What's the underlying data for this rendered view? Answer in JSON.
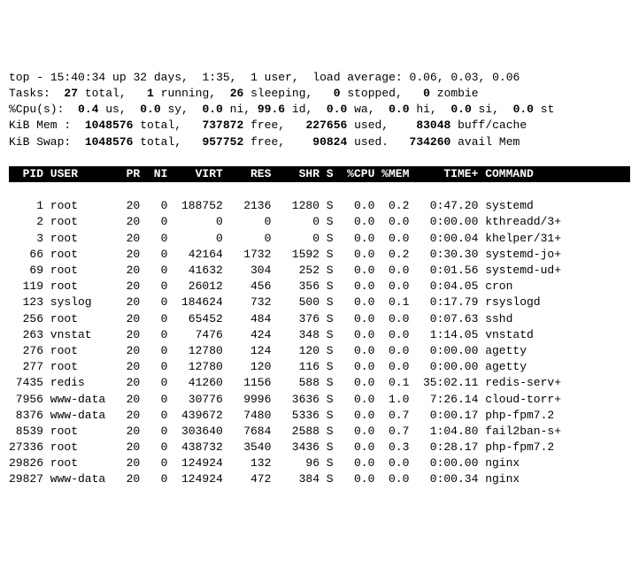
{
  "summary": {
    "line1_prefix": "top - ",
    "time": "15:40:34",
    "up_label": " up ",
    "uptime": "32 days,  1:35",
    "users_sep": ",  ",
    "users": "1 user",
    "load_label": ",  load average: ",
    "load": "0.06, 0.03, 0.06",
    "tasks_label": "Tasks:  ",
    "tasks_total": "27",
    "tasks_total_suffix": " total,   ",
    "tasks_running": "1",
    "tasks_running_suffix": " running,  ",
    "tasks_sleeping": "26",
    "tasks_sleeping_suffix": " sleeping,   ",
    "tasks_stopped": "0",
    "tasks_stopped_suffix": " stopped,   ",
    "tasks_zombie": "0",
    "tasks_zombie_suffix": " zombie",
    "cpu_label": "%Cpu(s):  ",
    "cpu_us": "0.4",
    "cpu_us_suffix": " us,  ",
    "cpu_sy": "0.0",
    "cpu_sy_suffix": " sy,  ",
    "cpu_ni": "0.0",
    "cpu_ni_suffix": " ni, ",
    "cpu_id": "99.6",
    "cpu_id_suffix": " id,  ",
    "cpu_wa": "0.0",
    "cpu_wa_suffix": " wa,  ",
    "cpu_hi": "0.0",
    "cpu_hi_suffix": " hi,  ",
    "cpu_si": "0.0",
    "cpu_si_suffix": " si,  ",
    "cpu_st": "0.0",
    "cpu_st_suffix": " st",
    "mem_label": "KiB Mem :  ",
    "mem_total": "1048576",
    "mem_total_suffix": " total,   ",
    "mem_free": "737872",
    "mem_free_suffix": " free,   ",
    "mem_used": "227656",
    "mem_used_suffix": " used,    ",
    "mem_buff": "83048",
    "mem_buff_suffix": " buff/cache",
    "swap_label": "KiB Swap:  ",
    "swap_total": "1048576",
    "swap_total_suffix": " total,   ",
    "swap_free": "957752",
    "swap_free_suffix": " free,    ",
    "swap_used": "90824",
    "swap_used_suffix": " used.   ",
    "swap_avail": "734260",
    "swap_avail_suffix": " avail Mem "
  },
  "columns": {
    "pid": "PID",
    "user": "USER",
    "pr": "PR",
    "ni": "NI",
    "virt": "VIRT",
    "res": "RES",
    "shr": "SHR",
    "s": "S",
    "cpu": "%CPU",
    "mem": "%MEM",
    "time": "TIME+",
    "cmd": "COMMAND"
  },
  "processes": [
    {
      "pid": "1",
      "user": "root",
      "pr": "20",
      "ni": "0",
      "virt": "188752",
      "res": "2136",
      "shr": "1280",
      "s": "S",
      "cpu": "0.0",
      "mem": "0.2",
      "time": "0:47.20",
      "cmd": "systemd"
    },
    {
      "pid": "2",
      "user": "root",
      "pr": "20",
      "ni": "0",
      "virt": "0",
      "res": "0",
      "shr": "0",
      "s": "S",
      "cpu": "0.0",
      "mem": "0.0",
      "time": "0:00.00",
      "cmd": "kthreadd/3+"
    },
    {
      "pid": "3",
      "user": "root",
      "pr": "20",
      "ni": "0",
      "virt": "0",
      "res": "0",
      "shr": "0",
      "s": "S",
      "cpu": "0.0",
      "mem": "0.0",
      "time": "0:00.04",
      "cmd": "khelper/31+"
    },
    {
      "pid": "66",
      "user": "root",
      "pr": "20",
      "ni": "0",
      "virt": "42164",
      "res": "1732",
      "shr": "1592",
      "s": "S",
      "cpu": "0.0",
      "mem": "0.2",
      "time": "0:30.30",
      "cmd": "systemd-jo+"
    },
    {
      "pid": "69",
      "user": "root",
      "pr": "20",
      "ni": "0",
      "virt": "41632",
      "res": "304",
      "shr": "252",
      "s": "S",
      "cpu": "0.0",
      "mem": "0.0",
      "time": "0:01.56",
      "cmd": "systemd-ud+"
    },
    {
      "pid": "119",
      "user": "root",
      "pr": "20",
      "ni": "0",
      "virt": "26012",
      "res": "456",
      "shr": "356",
      "s": "S",
      "cpu": "0.0",
      "mem": "0.0",
      "time": "0:04.05",
      "cmd": "cron"
    },
    {
      "pid": "123",
      "user": "syslog",
      "pr": "20",
      "ni": "0",
      "virt": "184624",
      "res": "732",
      "shr": "500",
      "s": "S",
      "cpu": "0.0",
      "mem": "0.1",
      "time": "0:17.79",
      "cmd": "rsyslogd"
    },
    {
      "pid": "256",
      "user": "root",
      "pr": "20",
      "ni": "0",
      "virt": "65452",
      "res": "484",
      "shr": "376",
      "s": "S",
      "cpu": "0.0",
      "mem": "0.0",
      "time": "0:07.63",
      "cmd": "sshd"
    },
    {
      "pid": "263",
      "user": "vnstat",
      "pr": "20",
      "ni": "0",
      "virt": "7476",
      "res": "424",
      "shr": "348",
      "s": "S",
      "cpu": "0.0",
      "mem": "0.0",
      "time": "1:14.05",
      "cmd": "vnstatd"
    },
    {
      "pid": "276",
      "user": "root",
      "pr": "20",
      "ni": "0",
      "virt": "12780",
      "res": "124",
      "shr": "120",
      "s": "S",
      "cpu": "0.0",
      "mem": "0.0",
      "time": "0:00.00",
      "cmd": "agetty"
    },
    {
      "pid": "277",
      "user": "root",
      "pr": "20",
      "ni": "0",
      "virt": "12780",
      "res": "120",
      "shr": "116",
      "s": "S",
      "cpu": "0.0",
      "mem": "0.0",
      "time": "0:00.00",
      "cmd": "agetty"
    },
    {
      "pid": "7435",
      "user": "redis",
      "pr": "20",
      "ni": "0",
      "virt": "41260",
      "res": "1156",
      "shr": "588",
      "s": "S",
      "cpu": "0.0",
      "mem": "0.1",
      "time": "35:02.11",
      "cmd": "redis-serv+"
    },
    {
      "pid": "7956",
      "user": "www-data",
      "pr": "20",
      "ni": "0",
      "virt": "30776",
      "res": "9996",
      "shr": "3636",
      "s": "S",
      "cpu": "0.0",
      "mem": "1.0",
      "time": "7:26.14",
      "cmd": "cloud-torr+"
    },
    {
      "pid": "8376",
      "user": "www-data",
      "pr": "20",
      "ni": "0",
      "virt": "439672",
      "res": "7480",
      "shr": "5336",
      "s": "S",
      "cpu": "0.0",
      "mem": "0.7",
      "time": "0:00.17",
      "cmd": "php-fpm7.2"
    },
    {
      "pid": "8539",
      "user": "root",
      "pr": "20",
      "ni": "0",
      "virt": "303640",
      "res": "7684",
      "shr": "2588",
      "s": "S",
      "cpu": "0.0",
      "mem": "0.7",
      "time": "1:04.80",
      "cmd": "fail2ban-s+"
    },
    {
      "pid": "27336",
      "user": "root",
      "pr": "20",
      "ni": "0",
      "virt": "438732",
      "res": "3540",
      "shr": "3436",
      "s": "S",
      "cpu": "0.0",
      "mem": "0.3",
      "time": "0:28.17",
      "cmd": "php-fpm7.2"
    },
    {
      "pid": "29826",
      "user": "root",
      "pr": "20",
      "ni": "0",
      "virt": "124924",
      "res": "132",
      "shr": "96",
      "s": "S",
      "cpu": "0.0",
      "mem": "0.0",
      "time": "0:00.00",
      "cmd": "nginx"
    },
    {
      "pid": "29827",
      "user": "www-data",
      "pr": "20",
      "ni": "0",
      "virt": "124924",
      "res": "472",
      "shr": "384",
      "s": "S",
      "cpu": "0.0",
      "mem": "0.0",
      "time": "0:00.34",
      "cmd": "nginx"
    }
  ]
}
